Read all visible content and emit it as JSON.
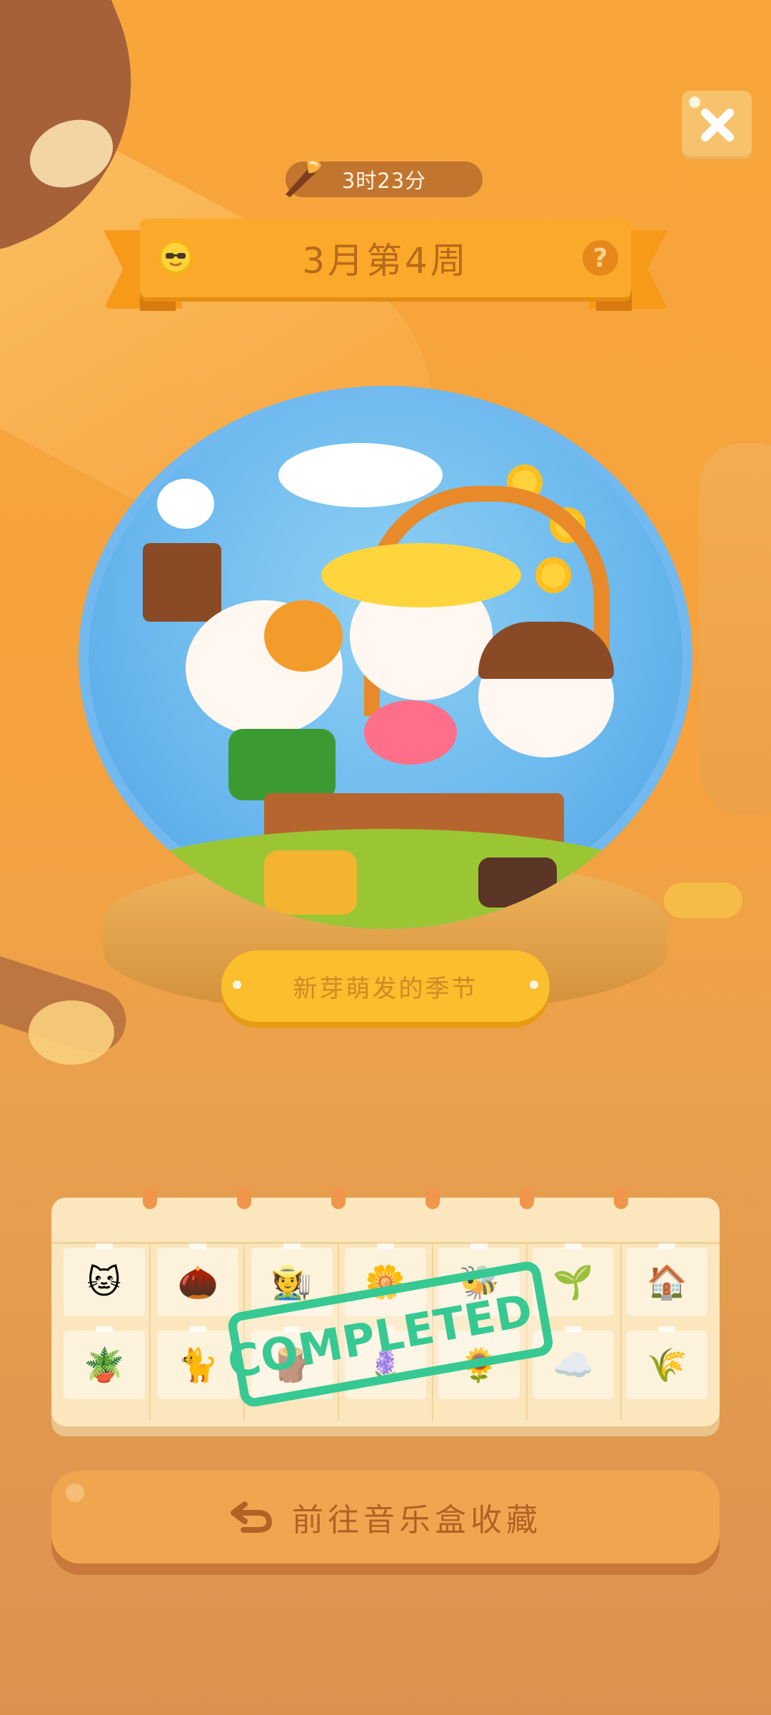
{
  "timer": {
    "text": "3时23分",
    "icon": "feather-brush-icon"
  },
  "banner": {
    "title": "3月第4周",
    "left_icon": "sun-sunglasses-icon",
    "help_icon": "question-icon",
    "help_label": "?"
  },
  "globe": {
    "plaque_text": "新芽萌发的季节"
  },
  "calendar": {
    "stamp_text": "COMPLETED!",
    "rows": [
      [
        "🐱",
        "🌰",
        "🧑‍🌾",
        "🌼",
        "🐝",
        "🌱",
        "🏠"
      ],
      [
        "🪴",
        "🐈",
        "🪵",
        "🪻",
        "🌻",
        "☁️",
        "🌾"
      ]
    ],
    "row_icons": [
      [
        "cat-portrait-icon",
        "bulb-icon",
        "gnome-icon",
        "boots-icon",
        "butterfly-icon",
        "trowel-icon",
        "birdhouse-icon"
      ],
      [
        "planter-icon",
        "straw-hat-cat-icon",
        "wheelbarrow-icon",
        "watering-can-icon",
        "flower-cat-icon",
        "cloud-icon",
        "trellis-icon"
      ]
    ]
  },
  "goto_button": {
    "label": "前往音乐盒收藏",
    "icon": "return-arrow-icon"
  },
  "close_button": {
    "icon": "close-icon"
  },
  "colors": {
    "accent": "#fba92a",
    "stamp": "#37c993",
    "button": "#f0a64f"
  }
}
